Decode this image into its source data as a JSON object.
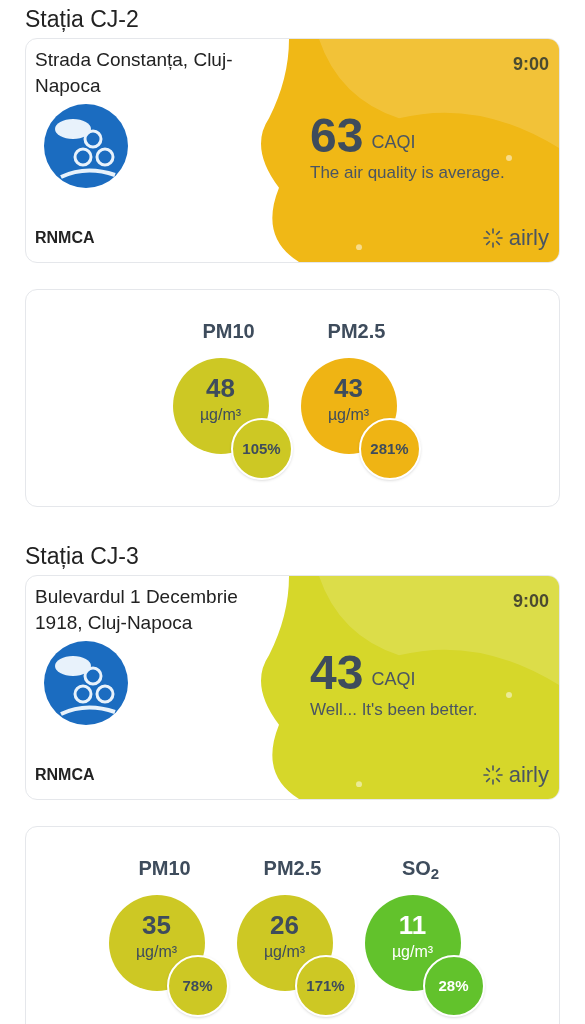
{
  "stations": [
    {
      "title": "Stația CJ-2",
      "address": "Strada Constanța, Cluj-Napoca",
      "time": "9:00",
      "provider": "RNMCA",
      "index": {
        "value": "63",
        "unit": "CAQI",
        "description": "The air quality is average.",
        "color": "#f0b816",
        "brand": "airly"
      },
      "pollutants": [
        {
          "name": "PM10",
          "value": "48",
          "unit": "µg/m³",
          "percent": "105%",
          "color": "#cdc824"
        },
        {
          "name": "PM2.5",
          "value": "43",
          "unit": "µg/m³",
          "percent": "281%",
          "color": "#efb414"
        }
      ]
    },
    {
      "title": "Stația CJ-3",
      "address": "Bulevardul 1 Decembrie 1918, Cluj-Napoca",
      "time": "9:00",
      "provider": "RNMCA",
      "index": {
        "value": "43",
        "unit": "CAQI",
        "description": "Well... It's been better.",
        "color": "#d6d72a",
        "brand": "airly"
      },
      "pollutants": [
        {
          "name": "PM10",
          "value": "35",
          "unit": "µg/m³",
          "percent": "78%",
          "color": "#cdc824"
        },
        {
          "name": "PM2.5",
          "value": "26",
          "unit": "µg/m³",
          "percent": "171%",
          "color": "#cdc824"
        },
        {
          "name": "SO$_{2}$",
          "value": "11",
          "unit": "µg/m³",
          "percent": "28%",
          "color": "#62c22c"
        }
      ]
    }
  ]
}
